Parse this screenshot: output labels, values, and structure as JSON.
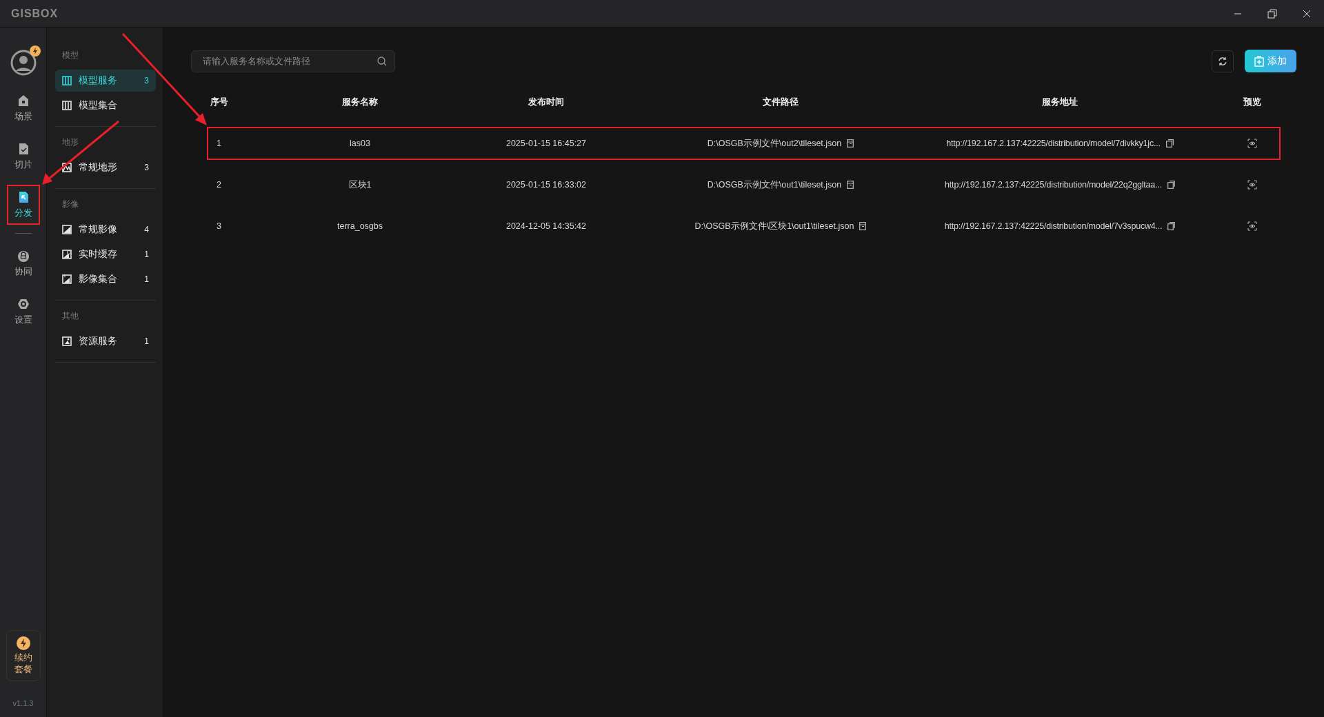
{
  "window": {
    "logo": "GISBOX"
  },
  "rail": {
    "groups": [
      [
        {
          "label": "场景",
          "kind": "house",
          "selected": false,
          "highlighted": false
        },
        {
          "label": "切片",
          "kind": "check",
          "selected": false,
          "highlighted": false
        },
        {
          "label": "分发",
          "kind": "share",
          "selected": true,
          "highlighted": true
        }
      ],
      [
        {
          "label": "协同",
          "kind": "lock",
          "selected": false,
          "highlighted": false
        },
        {
          "label": "设置",
          "kind": "gear",
          "selected": false,
          "highlighted": false
        }
      ]
    ],
    "promo": {
      "lines": [
        "续约",
        "套餐"
      ]
    },
    "version": "v1.1.3"
  },
  "sidebar": {
    "sections": [
      {
        "heading": "模型",
        "items": [
          {
            "label": "模型服务",
            "count": "3",
            "kind": "model",
            "selected": true
          },
          {
            "label": "模型集合",
            "kind": "model",
            "selected": false
          }
        ]
      },
      {
        "heading": "地形",
        "items": [
          {
            "label": "常规地形",
            "count": "3",
            "kind": "terrain",
            "selected": false
          }
        ]
      },
      {
        "heading": "影像",
        "items": [
          {
            "label": "常规影像",
            "count": "4",
            "kind": "image",
            "selected": false
          },
          {
            "label": "实时缓存",
            "count": "1",
            "kind": "cache",
            "selected": false
          },
          {
            "label": "影像集合",
            "count": "1",
            "kind": "imageset",
            "selected": false
          }
        ]
      },
      {
        "heading": "其他",
        "items": [
          {
            "label": "资源服务",
            "count": "1",
            "kind": "resource",
            "selected": false
          }
        ]
      }
    ]
  },
  "search": {
    "placeholder": "请输入服务名称或文件路径"
  },
  "toolbar": {
    "add_label": "添加"
  },
  "table": {
    "columns": [
      "序号",
      "服务名称",
      "发布时间",
      "文件路径",
      "服务地址",
      "预览"
    ],
    "rows": [
      {
        "index": "1",
        "name": "las03",
        "time": "2025-01-15 16:45:27",
        "path": "D:\\OSGB示例文件\\out2\\tileset.json",
        "url": "http://192.167.2.137:42225/distribution/model/7divkky1jc...",
        "highlighted": true
      },
      {
        "index": "2",
        "name": "区块1",
        "time": "2025-01-15 16:33:02",
        "path": "D:\\OSGB示例文件\\out1\\tileset.json",
        "url": "http://192.167.2.137:42225/distribution/model/22q2ggltaa...",
        "highlighted": false
      },
      {
        "index": "3",
        "name": "terra_osgbs",
        "time": "2024-12-05 14:35:42",
        "path": "D:\\OSGB示例文件\\区块1\\out1\\tileset.json",
        "url": "http://192.167.2.137:42225/distribution/model/7v3spucw4...",
        "highlighted": false
      }
    ]
  }
}
